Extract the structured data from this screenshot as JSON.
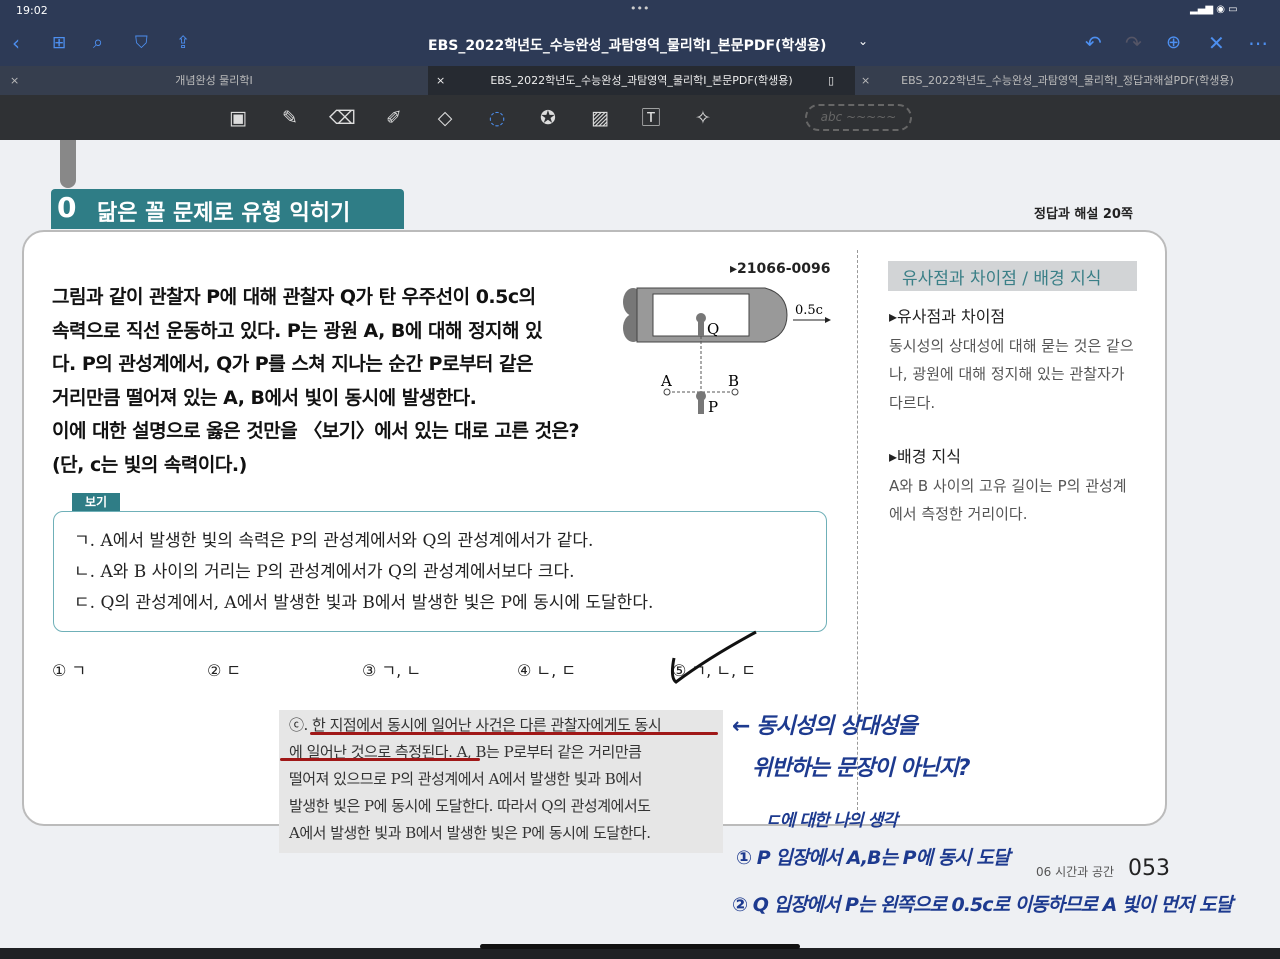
{
  "status": {
    "time": "19:02",
    "dots": "•••"
  },
  "nav": {
    "title": "EBS_2022학년도_수능완성_과탐영역_물리학I_본문PDF(학생용)",
    "title_chevron": "⌄"
  },
  "tabs": [
    {
      "label": "개념완성 물리학I",
      "active": false
    },
    {
      "label": "EBS_2022학년도_수능완성_과탐영역_물리학I_본문PDF(학생용)",
      "active": true
    },
    {
      "label": "EBS_2022학년도_수능완성_과탐영역_물리학I_정답과해설PDF(학생용)",
      "active": false
    }
  ],
  "toolbar": {
    "lasso_placeholder": "abc ~~~~~"
  },
  "page": {
    "section_number": "0",
    "section_title": "닮은 꼴 문제로 유형 익히기",
    "answer_ref": "정답과 해설 20쪽",
    "problem_id": "▸21066-0096",
    "question": [
      "그림과 같이 관찰자 P에 대해 관찰자 Q가 탄 우주선이 0.5c의",
      "속력으로 직선 운동하고 있다. P는 광원 A, B에 대해 정지해 있",
      "다. P의 관성계에서, Q가 P를 스쳐 지나는 순간 P로부터 같은",
      "거리만큼 떨어져 있는 A, B에서 빛이 동시에 발생한다.",
      "이에 대한 설명으로 옳은 것만을 〈보기〉에서 있는 대로 고른 것은?",
      "(단, c는 빛의 속력이다.)"
    ],
    "figure": {
      "speed": "0.5c",
      "labels": [
        "Q",
        "A",
        "B",
        "P"
      ]
    },
    "bogi_label": "보기",
    "bogi": [
      "ㄱ. A에서 발생한 빛의 속력은 P의 관성계에서와 Q의 관성계에서가 같다.",
      "ㄴ. A와 B 사이의 거리는 P의 관성계에서가 Q의 관성계에서보다 크다.",
      "ㄷ. Q의 관성계에서, A에서 발생한 빛과 B에서 발생한 빛은 P에 동시에 도달한다."
    ],
    "choices": [
      "① ㄱ",
      "② ㄷ",
      "③ ㄱ, ㄴ",
      "④ ㄴ, ㄷ",
      "⑤ ㄱ, ㄴ, ㄷ"
    ],
    "side": {
      "header": "유사점과 차이점 / 배경 지식",
      "h1": "▸유사점과 차이점",
      "p1": "동시성의 상대성에 대해 묻는 것은 같으나, 광원에 대해 정지해 있는 관찰자가 다르다.",
      "h2": "▸배경 지식",
      "p2": "A와 B 사이의 고유 길이는 P의 관성계에서 측정한 거리이다."
    },
    "explanation": [
      "ⓒ. 한 지점에서 동시에 일어난 사건은 다른 관찰자에게도 동시",
      "에 일어난 것으로 측정된다. A, B는 P로부터 같은 거리만큼",
      "떨어져 있으므로 P의 관성계에서 A에서 발생한 빛과 B에서",
      "발생한 빛은 P에 동시에 도달한다. 따라서 Q의 관성계에서도",
      "A에서 발생한 빛과 B에서 발생한 빛은 P에 동시에 도달한다."
    ],
    "footer_chapter": "06 시간과 공간",
    "page_number": "053"
  },
  "notes": {
    "n1": "← 동시성의 상대성을",
    "n2": "위반하는 문장이 아닌지?",
    "n3": "ㄷ에 대한 나의 생각",
    "n4": "① P 입장에서  A,B는  P에 동시 도달",
    "n5": "② Q 입장에서  P는  왼쪽으로 0.5c로 이동하므로  A 빛이 먼저 도달"
  },
  "colors": {
    "accent": "#4d8ff0",
    "section": "#2f7d86",
    "underline": "#a01818",
    "ink": "#1d3a8f"
  }
}
